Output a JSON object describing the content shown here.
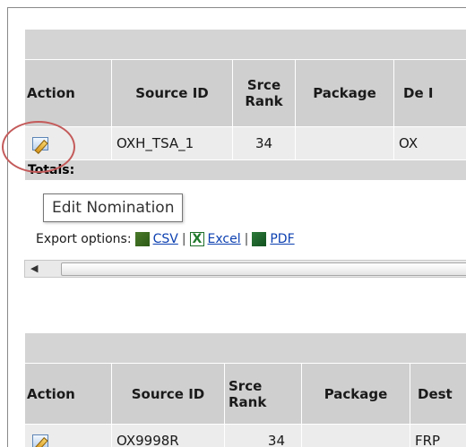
{
  "grid1": {
    "headers": [
      "Action",
      "Source ID",
      "Srce Rank",
      "Package",
      "De I"
    ],
    "rows": [
      {
        "source_id": "OXH_TSA_1",
        "srce_rank": "34",
        "package": "",
        "dest": "OX"
      }
    ],
    "totals_label": "Totals:"
  },
  "tooltip": {
    "text": "Edit Nomination"
  },
  "export": {
    "label": "Export options:",
    "csv": "CSV",
    "excel": "Excel",
    "pdf": "PDF",
    "separator": "|"
  },
  "scrollbar": {
    "left_arrow": "◀"
  },
  "grid2": {
    "headers": [
      "Action",
      "Source ID",
      "Srce Rank",
      "Package",
      "Dest"
    ],
    "rows": [
      {
        "source_id": "OX9998R",
        "srce_rank": "34",
        "package": "",
        "dest": "FRP_"
      }
    ]
  },
  "colors": {
    "header_bg": "#cfcfcf",
    "row_bg": "#ececec",
    "link": "#0b3fb0",
    "highlight": "#c45a5a"
  }
}
